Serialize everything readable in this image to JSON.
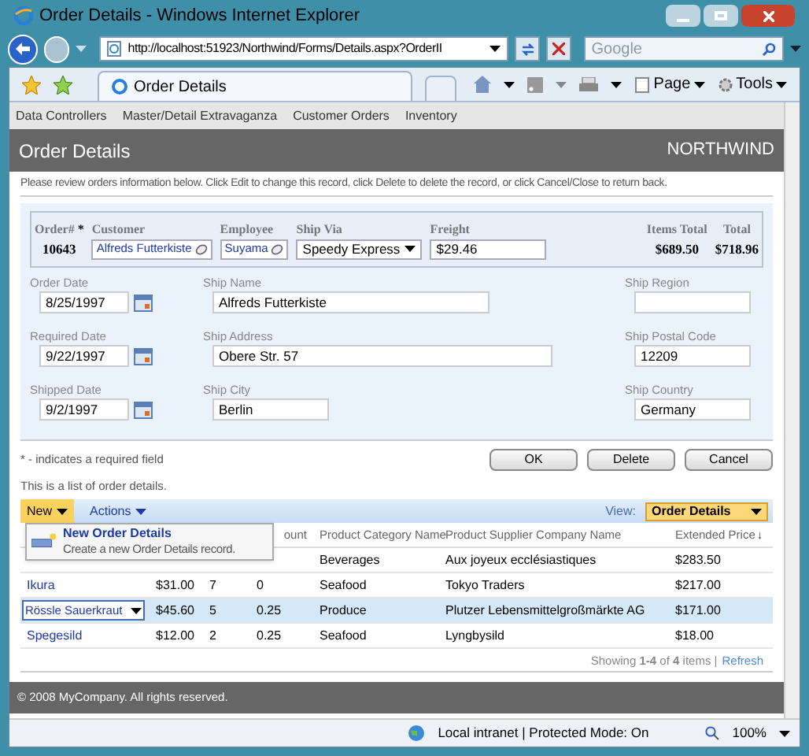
{
  "window": {
    "title": "Order Details - Windows Internet Explorer"
  },
  "address_bar": {
    "url": "http://localhost:51923/Northwind/Forms/Details.aspx?OrderII"
  },
  "search": {
    "placeholder": "Google"
  },
  "tabs": [
    {
      "label": "Order Details",
      "selected": true
    }
  ],
  "command_bar": [
    {
      "label": "Page"
    },
    {
      "label": "Tools"
    }
  ],
  "menu": [
    "Data Controllers",
    "Master/Detail Extravaganza",
    "Customer Orders",
    "Inventory"
  ],
  "page_header": {
    "title": "Order Details",
    "brand": "NORTHWIND"
  },
  "instructions": "Please review orders information below. Click Edit to change this record, click Delete to delete the record, or click Cancel/Close to return back.",
  "summary": [
    {
      "label": "Order#",
      "required_mark": "*",
      "value": "10643",
      "kind": "text"
    },
    {
      "label": "Customer",
      "value": "Alfreds Futterkiste",
      "kind": "lookup"
    },
    {
      "label": "Employee",
      "value": "Suyama",
      "kind": "lookup"
    },
    {
      "label": "Ship Via",
      "value": "Speedy Express",
      "kind": "select"
    },
    {
      "label": "Freight",
      "value": "$29.46",
      "kind": "input"
    },
    {
      "label": "Items Total",
      "value": "$689.50",
      "kind": "text"
    },
    {
      "label": "Total",
      "value": "$718.96",
      "kind": "text"
    }
  ],
  "form_columns": [
    [
      {
        "label": "Order Date",
        "value": "8/25/1997",
        "kind": "date"
      },
      {
        "label": "Required Date",
        "value": "9/22/1997",
        "kind": "date"
      },
      {
        "label": "Shipped Date",
        "value": "9/2/1997",
        "kind": "date"
      }
    ],
    [
      {
        "label": "Ship Name",
        "value": "Alfreds Futterkiste",
        "kind": "wide"
      },
      {
        "label": "Ship Address",
        "value": "Obere Str. 57",
        "kind": "wide"
      },
      {
        "label": "Ship City",
        "value": "Berlin",
        "kind": "short"
      }
    ],
    [
      {
        "label": "Ship Region",
        "kind": "short"
      },
      {
        "label": "Ship Postal Code",
        "value": "12209",
        "kind": "short"
      },
      {
        "label": "Ship Country",
        "value": "Germany",
        "kind": "short"
      }
    ]
  ],
  "footnote": "* - indicates a required field",
  "buttons": [
    "OK",
    "Delete",
    "Cancel"
  ],
  "list_caption": "This is a list of order details.",
  "grid_toolbar": {
    "new": "New",
    "actions": "Actions",
    "view_label": "View:",
    "view": "Order Details"
  },
  "new_menu": {
    "title": "New Order Details",
    "description": "Create a new Order Details record."
  },
  "columns": [
    {},
    {},
    {},
    {
      "label": "ount"
    },
    {
      "label": "Product Category Name"
    },
    {
      "label": "Product Supplier Company Name"
    },
    {
      "label": "Extended Price",
      "sort_mark": "↓"
    }
  ],
  "rows": [
    {
      "selected": false,
      "cells": [
        null,
        null,
        null,
        null,
        "Beverages",
        "Aux joyeux ecclésiastiques",
        "$283.50"
      ]
    },
    {
      "selected": false,
      "cells": [
        "Ikura",
        "$31.00",
        "7",
        "0",
        "Seafood",
        "Tokyo Traders",
        "$217.00"
      ]
    },
    {
      "selected": true,
      "cells": [
        "Rössle Sauerkraut",
        "$45.60",
        "5",
        "0.25",
        "Produce",
        "Plutzer Lebensmittelgroßmärkte AG",
        "$171.00"
      ]
    },
    {
      "selected": false,
      "cells": [
        "Spegesild",
        "$12.00",
        "2",
        "0.25",
        "Seafood",
        "Lyngbysild",
        "$18.00"
      ]
    }
  ],
  "pager": {
    "text": "Showing **1-4** of **4** items |",
    "link": "Refresh"
  },
  "footer": "© 2008 MyCompany. All rights reserved.",
  "status_bar": {
    "zone": "Local intranet | Protected Mode: On",
    "zoom": "100%"
  }
}
